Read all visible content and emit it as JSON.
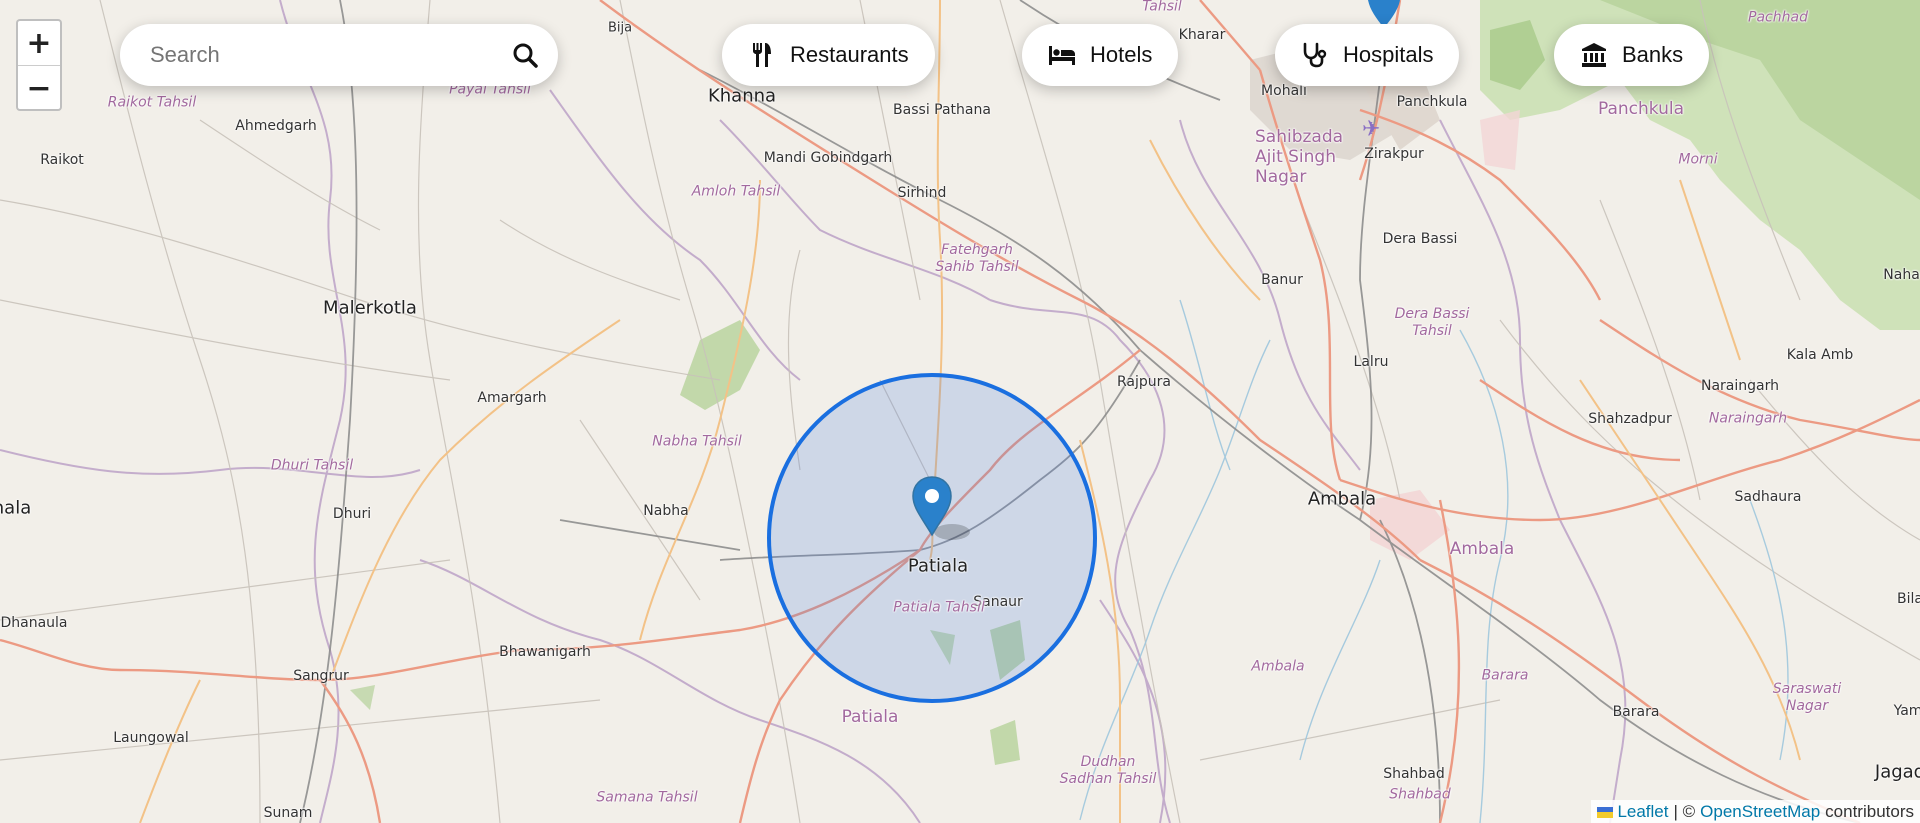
{
  "search": {
    "placeholder": "Search"
  },
  "categories": [
    {
      "label": "Restaurants",
      "icon": "utensils-icon"
    },
    {
      "label": "Hotels",
      "icon": "bed-icon"
    },
    {
      "label": "Hospitals",
      "icon": "stethoscope-icon"
    },
    {
      "label": "Banks",
      "icon": "bank-icon"
    }
  ],
  "zoom": {
    "in_label": "+",
    "out_label": "−"
  },
  "attribution": {
    "leaflet": "Leaflet",
    "separator": "| ©",
    "osm": "OpenStreetMap",
    "suffix": "contributors"
  },
  "map": {
    "marker_city": "Patiala",
    "circle_color": "#1a6fe0",
    "labels": [
      {
        "text": "Bija",
        "cls": "small"
      },
      {
        "text": "Khanna",
        "cls": "city"
      },
      {
        "text": "Bassi Pathana",
        "cls": "town"
      },
      {
        "text": "Tahsil",
        "cls": "admin"
      },
      {
        "text": "Kharar",
        "cls": "town"
      },
      {
        "text": "Mohali",
        "cls": "town"
      },
      {
        "text": "Panchkula",
        "cls": "town"
      },
      {
        "text": "Pachhad",
        "cls": "admin"
      },
      {
        "text": "Raikot Tahsil",
        "cls": "admin"
      },
      {
        "text": "Payal Tahsil",
        "cls": "admin"
      },
      {
        "text": "Ahmedgarh",
        "cls": "town"
      },
      {
        "text": "Raikot",
        "cls": "town"
      },
      {
        "text": "Mandi Gobindgarh",
        "cls": "town"
      },
      {
        "text": "Amloh Tahsil",
        "cls": "admin"
      },
      {
        "text": "Sirhind",
        "cls": "town"
      },
      {
        "text": "Sahibzada Ajit Singh Nagar",
        "cls": "region"
      },
      {
        "text": "Zirakpur",
        "cls": "town"
      },
      {
        "text": "Panchkula",
        "cls": "region"
      },
      {
        "text": "Morni",
        "cls": "admin"
      },
      {
        "text": "Fatehgarh Sahib Tahsil",
        "cls": "admin"
      },
      {
        "text": "Dera Bassi",
        "cls": "town"
      },
      {
        "text": "Nahan",
        "cls": "town"
      },
      {
        "text": "Malerkotla",
        "cls": "city"
      },
      {
        "text": "Banur",
        "cls": "town"
      },
      {
        "text": "Dera Bassi Tahsil",
        "cls": "admin"
      },
      {
        "text": "Lalru",
        "cls": "town"
      },
      {
        "text": "Kala Amb",
        "cls": "town"
      },
      {
        "text": "Rajpura",
        "cls": "town"
      },
      {
        "text": "Naraingarh",
        "cls": "town"
      },
      {
        "text": "Amargarh",
        "cls": "town"
      },
      {
        "text": "Nabha Tahsil",
        "cls": "admin"
      },
      {
        "text": "Shahzadpur",
        "cls": "town"
      },
      {
        "text": "Naraingarh",
        "cls": "admin"
      },
      {
        "text": "Dhuri Tahsil",
        "cls": "admin"
      },
      {
        "text": "Ambala",
        "cls": "city"
      },
      {
        "text": "Sadhaura",
        "cls": "town"
      },
      {
        "text": "nala",
        "cls": "city"
      },
      {
        "text": "Dhuri",
        "cls": "town"
      },
      {
        "text": "Nabha",
        "cls": "town"
      },
      {
        "text": "Ambala",
        "cls": "region"
      },
      {
        "text": "Patiala",
        "cls": "city"
      },
      {
        "text": "Sanaur",
        "cls": "town"
      },
      {
        "text": "Patiala Tahsil",
        "cls": "admin"
      },
      {
        "text": "Bila",
        "cls": "town"
      },
      {
        "text": "Dhanaula",
        "cls": "town"
      },
      {
        "text": "Bhawanigarh",
        "cls": "town"
      },
      {
        "text": "Sangrur",
        "cls": "town"
      },
      {
        "text": "Ambala",
        "cls": "admin"
      },
      {
        "text": "Barara",
        "cls": "admin"
      },
      {
        "text": "Saraswati Nagar",
        "cls": "admin"
      },
      {
        "text": "Yam",
        "cls": "town"
      },
      {
        "text": "Barara",
        "cls": "town"
      },
      {
        "text": "Patiala",
        "cls": "region"
      },
      {
        "text": "Laungowal",
        "cls": "town"
      },
      {
        "text": "Samana Tahsil",
        "cls": "admin"
      },
      {
        "text": "Dudhan Sadhan Tahsil",
        "cls": "admin"
      },
      {
        "text": "Shahbad",
        "cls": "town"
      },
      {
        "text": "Shahbad",
        "cls": "admin"
      },
      {
        "text": "Sunam",
        "cls": "town"
      },
      {
        "text": "Jagad",
        "cls": "city"
      }
    ]
  }
}
